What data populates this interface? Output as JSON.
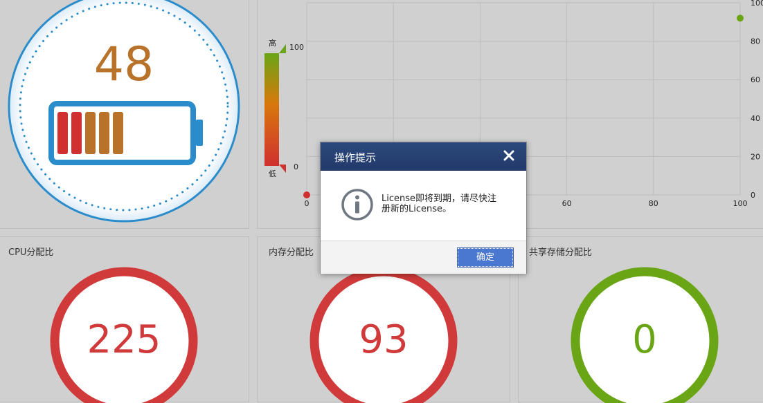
{
  "battery_panel": {
    "value": "48",
    "level_bars_filled": 5,
    "level_bars_total": 10,
    "colors": {
      "ring": "#2b8ccc",
      "value": "#b8722a",
      "bar_red": "#d03030",
      "bar_orange": "#b8722a"
    }
  },
  "legend": {
    "high_label": "高",
    "low_label": "低",
    "max": "100",
    "min": "0"
  },
  "chart_data": {
    "type": "scatter",
    "xlim": [
      0,
      100
    ],
    "ylim": [
      0,
      100
    ],
    "x_ticks": [
      "0",
      "20",
      "40",
      "60",
      "80",
      "100"
    ],
    "y_ticks": [
      "0",
      "20",
      "40",
      "60",
      "80",
      "100"
    ],
    "grid": true,
    "series": [
      {
        "points": [
          {
            "x": 0,
            "y": 0,
            "color": "#d03030"
          },
          {
            "x": 100,
            "y": 92,
            "color": "#6aa516"
          }
        ]
      }
    ]
  },
  "gauges": [
    {
      "title": "CPU分配比",
      "value": "225",
      "color": "#d03a3a"
    },
    {
      "title": "内存分配比",
      "value": "93",
      "color": "#d03a3a"
    },
    {
      "title": "共享存储分配比",
      "value": "0",
      "color": "#6aa516"
    }
  ],
  "dialog": {
    "title": "操作提示",
    "message_line1": "License即将到期，请尽快注",
    "message_line2": "册新的License。",
    "ok_label": "确定",
    "icon": "info-icon",
    "close_icon": "close-icon"
  }
}
